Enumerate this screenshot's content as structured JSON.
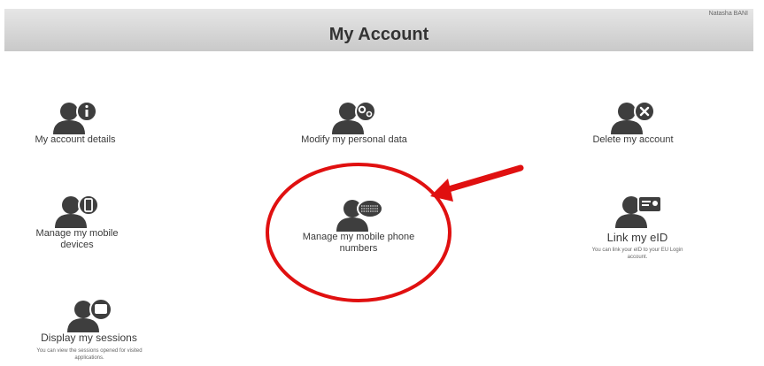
{
  "header": {
    "title": "My Account",
    "user_name": "Natasha BANI"
  },
  "tiles": {
    "account_details": {
      "label": "My account details",
      "icon": "person-info-icon"
    },
    "modify_personal_data": {
      "label": "Modify my personal data",
      "icon": "person-gears-icon"
    },
    "delete_account": {
      "label": "Delete my account",
      "icon": "person-x-icon"
    },
    "mobile_devices": {
      "label": "Manage my mobile devices",
      "icon": "person-phone-icon"
    },
    "mobile_numbers": {
      "label": "Manage my mobile phone numbers",
      "icon": "person-keypad-icon"
    },
    "link_eid": {
      "label": "Link my eID",
      "icon": "person-card-icon",
      "description": "You can link your eID to your EU Login account."
    },
    "sessions": {
      "label": "Display my sessions",
      "icon": "person-screen-icon",
      "description": "You can view the sessions opened for visited applications."
    }
  },
  "colors": {
    "header_bg": "#d4d4d4",
    "icon_gray": "#3e3e3e",
    "highlight_red": "#e01010"
  }
}
